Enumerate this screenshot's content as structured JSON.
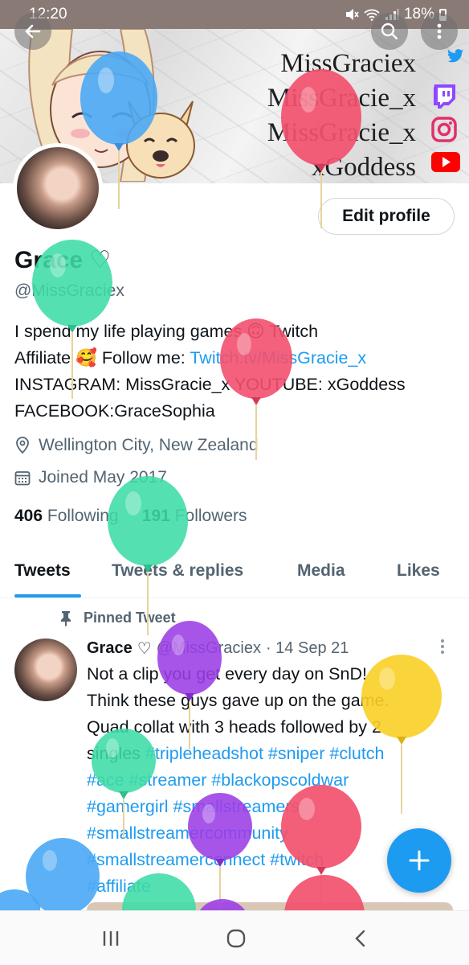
{
  "status_bar": {
    "time": "12:20",
    "battery": "18%"
  },
  "banner": {
    "lines": [
      "MissGraciex",
      "MissGracie_x",
      "MissGracie_x",
      "xGoddess"
    ],
    "icons": [
      "twitter-icon",
      "twitch-icon",
      "instagram-icon",
      "youtube-icon"
    ]
  },
  "profile": {
    "edit_label": "Edit profile",
    "name": "Grace",
    "name_suffix": "♡",
    "handle": "@MissGraciex",
    "bio_1": "I spend my life playing games 🙃 Twitch",
    "bio_2a": "Affiliate 🥰  Follow me: ",
    "bio_2b": "Twitch.tv/MissGracie_x",
    "bio_3": "INSTAGRAM: MissGracie_x YOUTUBE: xGoddess",
    "bio_4": "FACEBOOK:GraceSophia",
    "location": "Wellington City, New Zealand",
    "joined": "Joined May 2017",
    "following_count": "406",
    "following_label": "Following",
    "followers_count": "191",
    "followers_label": "Followers"
  },
  "tabs": [
    "Tweets",
    "Tweets & replies",
    "Media",
    "Likes"
  ],
  "tweet": {
    "pinned_label": "Pinned Tweet",
    "author": "Grace",
    "author_suffix": "♡",
    "handle": "@MissGraciex",
    "date": "· 14 Sep 21",
    "text_1": "Not a clip you get every day on SnD!",
    "text_2": "Think these guys gave up on the game.",
    "text_3": "Quad collat with 3 heads followed by 2",
    "text_4a": "singles ",
    "tags_4": "#tripleheadshot #sniper #clutch",
    "tags_5": "#ace #streamer #blackopscoldwar",
    "tags_6": "#gamergirl #smallstreamers",
    "tags_7": "#smallstreamercommunity",
    "tags_8": "#smallstreamerconnect #twitch",
    "tags_9": "#affiliate"
  },
  "colors": {
    "accent": "#1d9bf0",
    "muted": "#536471",
    "text": "#0f1419"
  }
}
